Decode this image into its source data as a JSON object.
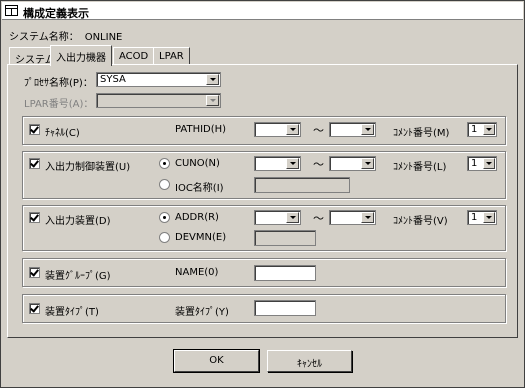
{
  "window": {
    "title": "構成定義表示"
  },
  "system": {
    "label": "システム名称：",
    "value": "ONLINE"
  },
  "tabs": [
    {
      "label": "システム",
      "active": false
    },
    {
      "label": "入出力機器",
      "active": true
    },
    {
      "label": "ACOD",
      "active": false
    },
    {
      "label": "LPAR",
      "active": false
    }
  ],
  "processor": {
    "label": "ﾌﾟﾛｾｻ名称(P)：",
    "value": "SYSA"
  },
  "lpar": {
    "label": "LPAR番号(A)：",
    "value": ""
  },
  "groups": {
    "channel": {
      "check_label": "ﾁｬﾈﾙ(C)",
      "checked": true,
      "field_label": "PATHID(H)",
      "from": "",
      "to": "",
      "comment_label": "ｺﾒﾝﾄ番号(M)",
      "comment_value": "1"
    },
    "control_unit": {
      "check_label": "入出力制御装置(U)",
      "checked": true,
      "radio1_label": "CUNO(N)",
      "radio1_checked": true,
      "from": "",
      "to": "",
      "radio2_label": "IOC名称(I)",
      "radio2_checked": false,
      "comment_label": "ｺﾒﾝﾄ番号(L)",
      "comment_value": "1"
    },
    "device": {
      "check_label": "入出力装置(D)",
      "checked": true,
      "radio1_label": "ADDR(R)",
      "radio1_checked": true,
      "from": "",
      "to": "",
      "radio2_label": "DEVMN(E)",
      "radio2_checked": false,
      "comment_label": "ｺﾒﾝﾄ番号(V)",
      "comment_value": "1"
    },
    "device_group": {
      "check_label": "装置ｸﾞﾙｰﾌﾟ(G)",
      "checked": true,
      "field_label": "NAME(0)",
      "value": ""
    },
    "device_type": {
      "check_label": "装置ﾀｲﾌﾟ(T)",
      "checked": true,
      "field_label": "装置ﾀｲﾌﾟ(Y)",
      "value": ""
    }
  },
  "range_separator": "～",
  "buttons": {
    "ok": "OK",
    "cancel": "ｷｬﾝｾﾙ"
  },
  "colors": {
    "face": "#d4d0c8",
    "shadow": "#808080",
    "highlight": "#ffffff"
  }
}
